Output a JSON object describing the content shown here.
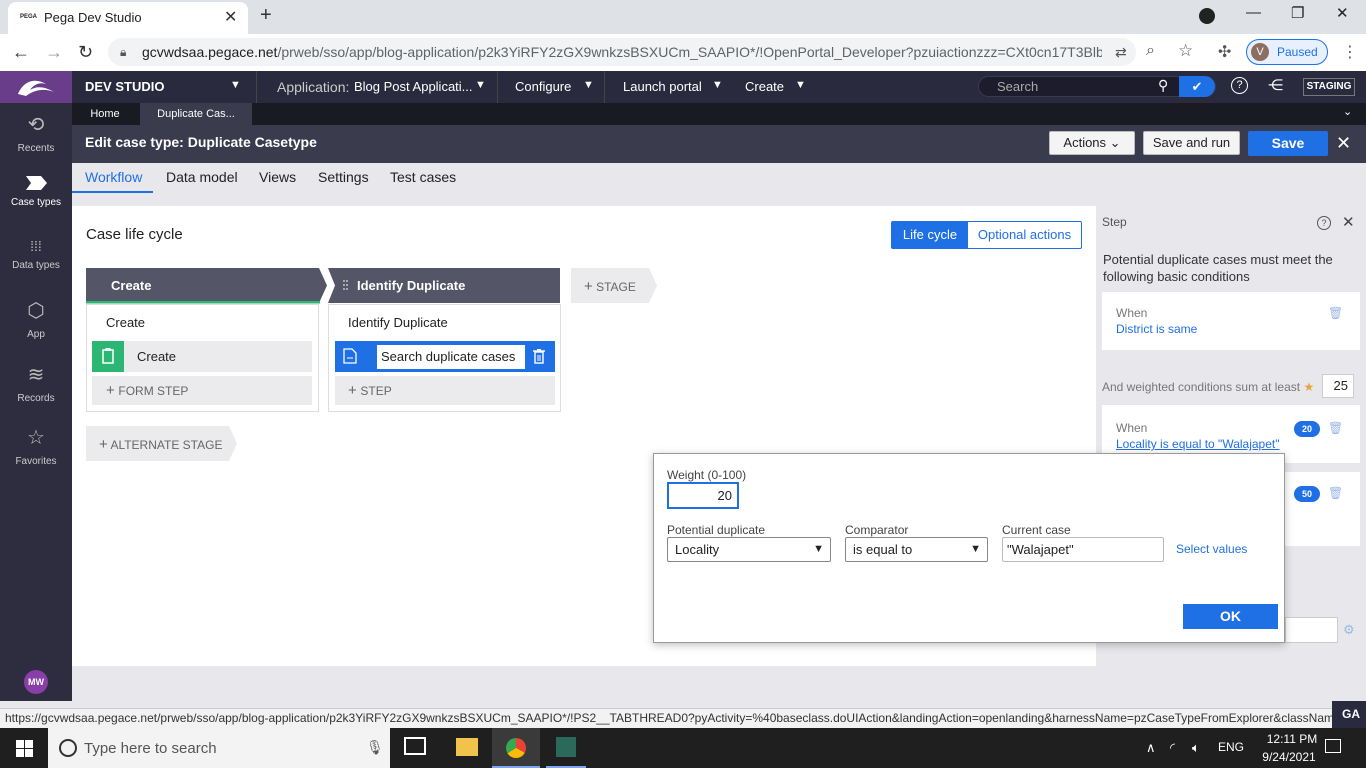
{
  "browser": {
    "tab_title": "Pega Dev Studio",
    "tab_favicon_text": "PEGA",
    "url_host": "gcvwdsaa.pegace.net",
    "url_path": "/prweb/sso/app/blog-application/p2k3YiRFY2zGX9wnkzsBSXUCm_SAAPIO*/!OpenPortal_Developer?pzuiactionzzz=CXt0cn17T3BlbIB...",
    "profile_initial": "V",
    "profile_status": "Paused"
  },
  "pega_header": {
    "studio_label": "DEV STUDIO",
    "application_label": "Application:",
    "application_value": "Blog Post Applicati...",
    "menu_configure": "Configure",
    "menu_launch_portal": "Launch portal",
    "menu_create": "Create",
    "search_placeholder": "Search",
    "environment_badge": "STAGING"
  },
  "left_nav": {
    "items": [
      {
        "label": "Recents",
        "icon": "history-icon"
      },
      {
        "label": "Case types",
        "icon": "case-types-icon"
      },
      {
        "label": "Data types",
        "icon": "data-types-icon"
      },
      {
        "label": "App",
        "icon": "app-cube-icon"
      },
      {
        "label": "Records",
        "icon": "records-stack-icon"
      },
      {
        "label": "Favorites",
        "icon": "star-icon"
      }
    ],
    "user_initials": "MW"
  },
  "work_tabs": [
    "Home",
    "Duplicate Cas..."
  ],
  "title_bar": {
    "prefix": "Edit case type:",
    "name": "Duplicate Casetype",
    "actions_label": "Actions",
    "save_and_run_label": "Save and run",
    "save_label": "Save"
  },
  "sub_tabs": [
    "Workflow",
    "Data model",
    "Views",
    "Settings",
    "Test cases"
  ],
  "lifecycle": {
    "title": "Case life cycle",
    "toggle_lifecycle": "Life cycle",
    "toggle_optional": "Optional actions",
    "stages": [
      {
        "name": "Create",
        "process": "Create",
        "step": "Create",
        "add_label": "FORM STEP"
      },
      {
        "name": "Identify Duplicate",
        "process": "Identify Duplicate",
        "step": "Search duplicate cases",
        "add_label": "STEP"
      }
    ],
    "add_stage_label": "STAGE",
    "add_alternate_label": "ALTERNATE STAGE"
  },
  "step_panel": {
    "header": "Step",
    "description": "Potential duplicate cases must meet the following basic conditions",
    "basic_when_label": "When",
    "basic_condition": "District is same",
    "weighted_label": "And weighted conditions sum at least",
    "weighted_value": "25",
    "weighted_when_label": "When",
    "weighted_condition": "Locality is equal to \"Walajapet\"",
    "weight_badge_1": "20",
    "weight_badge_2": "50"
  },
  "popup": {
    "weight_label": "Weight (0-100)",
    "weight_value": "20",
    "potential_duplicate_label": "Potential duplicate",
    "potential_duplicate_value": "Locality",
    "comparator_label": "Comparator",
    "comparator_value": "is equal to",
    "current_case_label": "Current case",
    "current_case_value": "\"Walajapet\"",
    "select_values_link": "Select values",
    "ok_label": "OK"
  },
  "status_url": "https://gcvwdsaa.pegace.net/prweb/sso/app/blog-application/p2k3YiRFY2zGX9wnkzsBSXUCm_SAAPIO*/!PS2__TABTHREAD0?pyActivity=%40baseclass.doUIAction&landingAction=openlanding&harnessName=pzCaseTypeFromExplorer&className=...",
  "status_edge_text": "GA",
  "taskbar": {
    "search_placeholder": "Type here to search",
    "language": "ENG",
    "time": "12:11 PM",
    "date": "9/24/2021"
  },
  "colors": {
    "accent": "#1f6fe5",
    "header": "#2a2a3e",
    "nav": "#2d2d3f",
    "logo": "#6a3d8a"
  }
}
